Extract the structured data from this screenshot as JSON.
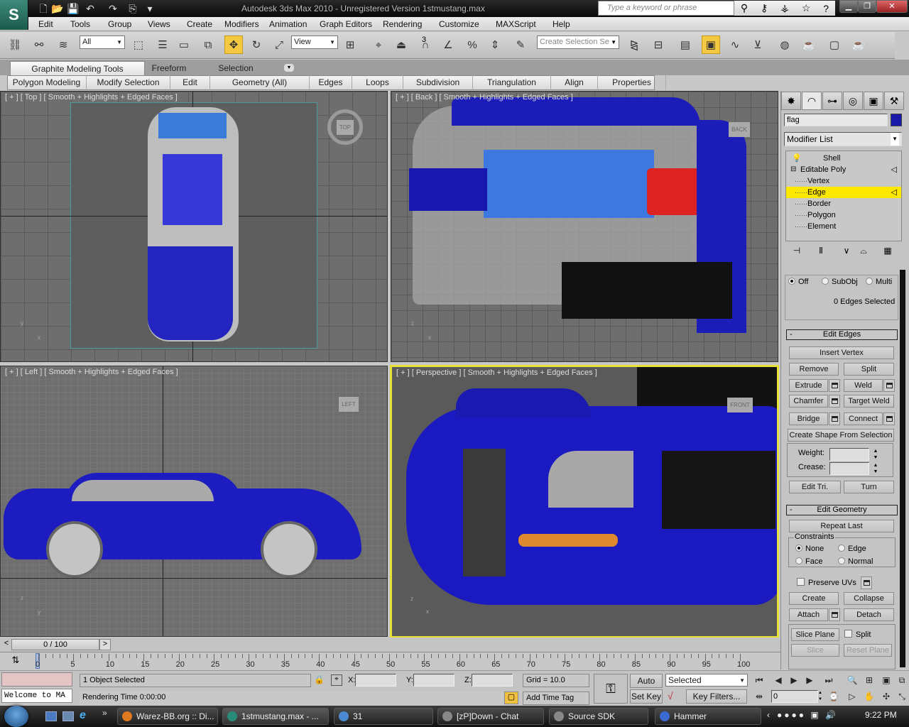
{
  "titlebar": {
    "window_title": "Autodesk 3ds Max  2010  - Unregistered Version      1stmustang.max",
    "search_placeholder": "Type a keyword or phrase",
    "logo_glyph": "S"
  },
  "quick_access": [
    {
      "name": "new-file-icon",
      "glyph": "🗋"
    },
    {
      "name": "open-file-icon",
      "glyph": "📂"
    },
    {
      "name": "save-icon",
      "glyph": "💾"
    },
    {
      "name": "undo-icon",
      "glyph": "↶"
    },
    {
      "name": "redo-icon",
      "glyph": "↷"
    },
    {
      "name": "project-folder-icon",
      "glyph": "⎘"
    },
    {
      "name": "customize-dropdown-icon",
      "glyph": "▾"
    }
  ],
  "menu": [
    "Edit",
    "Tools",
    "Group",
    "Views",
    "Create",
    "Modifiers",
    "Animation",
    "Graph Editors",
    "Rendering",
    "Customize",
    "MAXScript",
    "Help"
  ],
  "toolbar": {
    "selection_filter": "All",
    "ref_coord": "View",
    "named_selection_placeholder": "Create Selection Se",
    "snap_label": "3",
    "icons": [
      {
        "name": "select-and-link-icon",
        "glyph": "⛓"
      },
      {
        "name": "unlink-icon",
        "glyph": "⚯"
      },
      {
        "name": "bind-space-warp-icon",
        "glyph": "≋"
      },
      {
        "name": "select-object-icon",
        "glyph": "⬚"
      },
      {
        "name": "select-by-name-icon",
        "glyph": "☰"
      },
      {
        "name": "rect-selection-icon",
        "glyph": "▭"
      },
      {
        "name": "window-crossing-icon",
        "glyph": "⧉"
      },
      {
        "name": "select-move-icon",
        "glyph": "✥"
      },
      {
        "name": "select-rotate-icon",
        "glyph": "↻"
      },
      {
        "name": "select-scale-icon",
        "glyph": "⤢"
      },
      {
        "name": "pivot-center-icon",
        "glyph": "⊞"
      },
      {
        "name": "manipulate-icon",
        "glyph": "⌖"
      },
      {
        "name": "keyboard-shortcut-icon",
        "glyph": "⏏"
      },
      {
        "name": "snap-toggle-icon",
        "glyph": "∩"
      },
      {
        "name": "angle-snap-icon",
        "glyph": "∠"
      },
      {
        "name": "percent-snap-icon",
        "glyph": "%"
      },
      {
        "name": "spinner-snap-icon",
        "glyph": "⇕"
      },
      {
        "name": "edit-named-selection-icon",
        "glyph": "✎"
      },
      {
        "name": "mirror-icon",
        "glyph": "⧎"
      },
      {
        "name": "align-icon",
        "glyph": "⊟"
      },
      {
        "name": "layer-manager-icon",
        "glyph": "▤"
      },
      {
        "name": "graphite-toggle-icon",
        "glyph": "▣"
      },
      {
        "name": "curve-editor-icon",
        "glyph": "∿"
      },
      {
        "name": "schematic-view-icon",
        "glyph": "⊻"
      },
      {
        "name": "material-editor-icon",
        "glyph": "◍"
      },
      {
        "name": "render-setup-icon",
        "glyph": "☕"
      },
      {
        "name": "rendered-frame-icon",
        "glyph": "▢"
      },
      {
        "name": "quick-render-icon",
        "glyph": "☕"
      }
    ]
  },
  "ribbon": {
    "tabs": [
      "Graphite Modeling Tools",
      "Freeform",
      "Selection"
    ],
    "panels": [
      "Polygon Modeling",
      "Modify Selection",
      "Edit",
      "Geometry (All)",
      "Edges",
      "Loops",
      "Subdivision",
      "Triangulation",
      "Align",
      "Properties"
    ]
  },
  "viewports": [
    {
      "label": "[ + ] [ Top ] [ Smooth + Highlights + Edged Faces ]",
      "cube": "TOP",
      "axis_a": "y",
      "axis_b": "x"
    },
    {
      "label": "[ + ] [ Back ] [ Smooth + Highlights + Edged Faces ]",
      "cube": "BACK",
      "axis_a": "z",
      "axis_b": "x"
    },
    {
      "label": "[ + ] [ Left ] [ Smooth + Highlights + Edged Faces ]",
      "cube": "LEFT",
      "axis_a": "z",
      "axis_b": "y"
    },
    {
      "label": "[ + ] [ Perspective ] [ Smooth + Highlights + Edged Faces ]",
      "cube": "FRONT",
      "axis_a": "z",
      "axis_b": "x"
    }
  ],
  "command_panel": {
    "tabs": [
      {
        "name": "create-tab-icon",
        "glyph": "✸"
      },
      {
        "name": "modify-tab-icon",
        "glyph": "◠"
      },
      {
        "name": "hierarchy-tab-icon",
        "glyph": "⊶"
      },
      {
        "name": "motion-tab-icon",
        "glyph": "◎"
      },
      {
        "name": "display-tab-icon",
        "glyph": "▣"
      },
      {
        "name": "utilities-tab-icon",
        "glyph": "⚒"
      }
    ],
    "object_name": "flag",
    "object_color": "#1a1aa8",
    "modifier_list": "Modifier List",
    "stack": [
      {
        "label": "Shell",
        "level": 0
      },
      {
        "label": "Editable Poly",
        "level": 0
      },
      {
        "label": "Vertex",
        "level": 1
      },
      {
        "label": "Edge",
        "level": 1,
        "selected": true
      },
      {
        "label": "Border",
        "level": 1
      },
      {
        "label": "Polygon",
        "level": 1
      },
      {
        "label": "Element",
        "level": 1
      }
    ],
    "stack_tools": [
      {
        "name": "pin-stack-icon",
        "glyph": "⊣"
      },
      {
        "name": "show-end-result-icon",
        "glyph": "Ⅱ"
      },
      {
        "name": "make-unique-icon",
        "glyph": "∨"
      },
      {
        "name": "remove-modifier-icon",
        "glyph": "⌓"
      },
      {
        "name": "configure-modifier-sets-icon",
        "glyph": "▦"
      }
    ],
    "preview": {
      "options": [
        "Off",
        "SubObj",
        "Multi"
      ],
      "selected": "Off",
      "status": "0 Edges Selected"
    },
    "edit_edges": {
      "title": "Edit Edges",
      "insert_vertex": "Insert Vertex",
      "remove": "Remove",
      "split": "Split",
      "extrude": "Extrude",
      "weld": "Weld",
      "chamfer": "Chamfer",
      "target_weld": "Target Weld",
      "bridge": "Bridge",
      "connect": "Connect",
      "create_shape": "Create Shape From Selection",
      "weight_label": "Weight:",
      "crease_label": "Crease:",
      "weight_value": "",
      "crease_value": "",
      "edit_tri": "Edit Tri.",
      "turn": "Turn"
    },
    "edit_geometry": {
      "title": "Edit Geometry",
      "repeat_last": "Repeat Last",
      "constraints_label": "Constraints",
      "constraints": [
        "None",
        "Edge",
        "Face",
        "Normal"
      ],
      "constraint_selected": "None",
      "preserve_uvs": "Preserve UVs",
      "create": "Create",
      "collapse": "Collapse",
      "attach": "Attach",
      "detach": "Detach",
      "slice_plane": "Slice Plane",
      "split": "Split",
      "slice": "Slice",
      "reset_plane": "Reset Plane"
    }
  },
  "timeline": {
    "slider": "0 / 100",
    "prev": "<",
    "next": ">",
    "current_frame": 0,
    "ticks": [
      "0",
      "5",
      "10",
      "15",
      "20",
      "25",
      "30",
      "35",
      "40",
      "45",
      "50",
      "55",
      "60",
      "65",
      "70",
      "75",
      "80",
      "85",
      "90",
      "95",
      "100"
    ]
  },
  "status": {
    "maxscript_output": "Welcome to MA",
    "selection": "1 Object Selected",
    "prompt": "Rendering Time  0:00:00",
    "x_label": "X:",
    "y_label": "Y:",
    "z_label": "Z:",
    "x_value": "",
    "y_value": "",
    "z_value": "",
    "grid": "Grid = 10.0",
    "add_time_tag": "Add Time Tag",
    "auto_key": "Auto Key",
    "set_key": "Set Key",
    "key_mode": "Selected",
    "key_filters": "Key Filters...",
    "frame_field": "0"
  },
  "taskbar": {
    "items": [
      {
        "label": "Warez-BB.org :: Di...",
        "color": "#e07a20"
      },
      {
        "label": "1stmustang.max - ...",
        "color": "#2a8a7a",
        "active": true
      },
      {
        "label": "31",
        "color": "#4a8ad0"
      },
      {
        "label": "[zP]Down - Chat",
        "color": "#888"
      },
      {
        "label": "Source SDK",
        "color": "#888"
      },
      {
        "label": "Hammer",
        "color": "#3a6ad0"
      }
    ],
    "clock": "9:22 PM"
  }
}
